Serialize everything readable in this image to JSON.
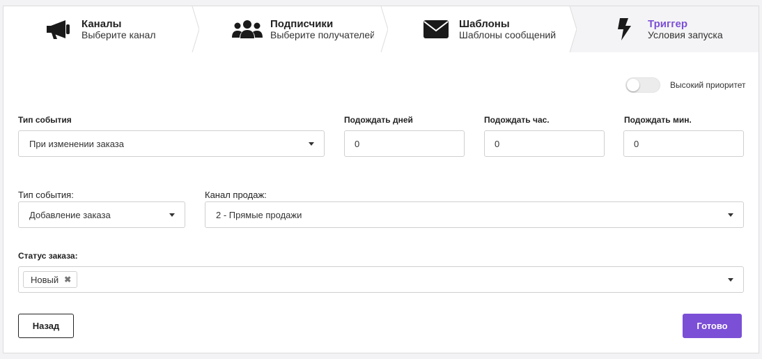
{
  "steps": [
    {
      "icon": "megaphone-icon",
      "title": "Каналы",
      "sub": "Выберите канал"
    },
    {
      "icon": "users-icon",
      "title": "Подписчики",
      "sub": "Выберите получателей"
    },
    {
      "icon": "envelope-icon",
      "title": "Шаблоны",
      "sub": "Шаблоны сообщений"
    },
    {
      "icon": "lightning-icon",
      "title": "Триггер",
      "sub": "Условия запуска"
    }
  ],
  "priority": {
    "label": "Высокий приоритет",
    "enabled": false
  },
  "event_type": {
    "label": "Тип события",
    "value": "При изменении заказа"
  },
  "wait_days": {
    "label": "Подождать дней",
    "value": "0"
  },
  "wait_hours": {
    "label": "Подождать час.",
    "value": "0"
  },
  "wait_minutes": {
    "label": "Подождать мин.",
    "value": "0"
  },
  "sub_event_type": {
    "label": "Тип события:",
    "value": "Добавление заказа"
  },
  "sales_channel": {
    "label": "Канал продаж:",
    "value": "2 - Прямые продажи"
  },
  "order_status": {
    "label": "Статус заказа:",
    "chips": [
      "Новый"
    ]
  },
  "buttons": {
    "back": "Назад",
    "done": "Готово"
  },
  "colors": {
    "accent": "#7b4fd6",
    "border": "#cfcfcf"
  }
}
